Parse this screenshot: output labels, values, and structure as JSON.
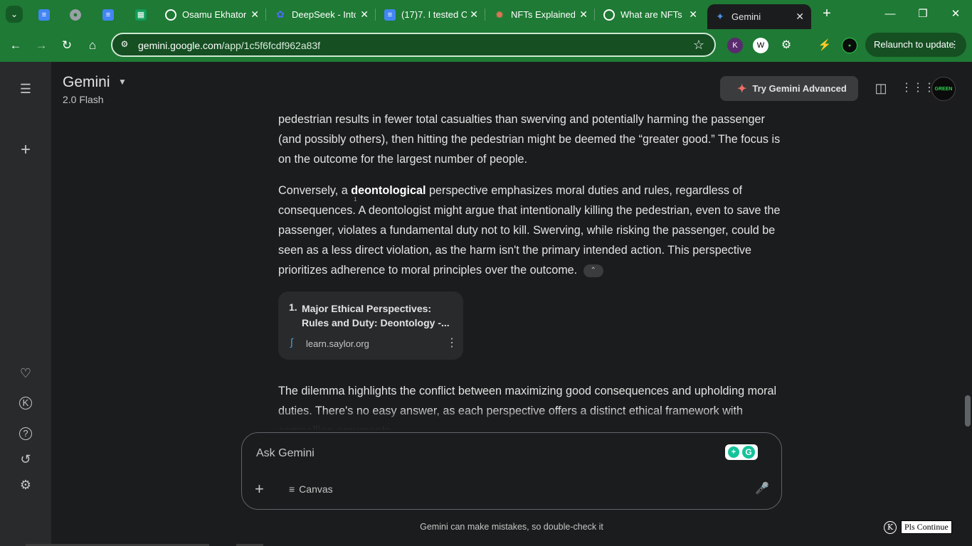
{
  "browser": {
    "tabs": [
      {
        "title": "",
        "icon": "google-docs-icon",
        "color": "#4285f4"
      },
      {
        "title": "",
        "icon": "globe-icon",
        "color": "#9aa0a6"
      },
      {
        "title": "",
        "icon": "google-docs-icon",
        "color": "#4285f4"
      },
      {
        "title": "",
        "icon": "google-sheets-icon",
        "color": "#0f9d58"
      },
      {
        "title": "Osamu Ekhator",
        "icon": "openai-icon",
        "color": "#ffffff"
      },
      {
        "title": "DeepSeek - Into",
        "icon": "deepseek-icon",
        "color": "#4d6bfe"
      },
      {
        "title": "(17)7. I tested C",
        "icon": "google-docs-icon",
        "color": "#4285f4"
      },
      {
        "title": "NFTs Explained",
        "icon": "claude-icon",
        "color": "#d97757"
      },
      {
        "title": "What are NFTs",
        "icon": "openai-icon",
        "color": "#ffffff"
      },
      {
        "title": "Gemini",
        "icon": "gemini-icon",
        "color": "#4a90e2"
      }
    ],
    "url_host": "gemini.google.com",
    "url_path": "/app/1c5f6fcdf962a83f",
    "relaunch_label": "Relaunch to update"
  },
  "header": {
    "title": "Gemini",
    "model": "2.0 Flash",
    "try_advanced": "Try Gemini Advanced"
  },
  "content": {
    "p1": "pedestrian results in fewer total casualties than swerving and potentially harming the passenger (and possibly others), then hitting the pedestrian might be deemed the “greater good.” The focus is on the outcome for the largest number of people.",
    "p2_before": "Conversely, a ",
    "p2_bold": "deontological",
    "p2_after": " perspective emphasizes moral duties and rules, regardless of consequences. A deontologist might argue that intentionally killing the pedestrian, even to save the passenger, violates a fundamental duty not to kill. Swerving, while risking the passenger, could be seen as a less direct violation, as the harm isn't the primary intended action. This perspective prioritizes adherence to moral principles over the outcome.",
    "citation_sup": "1",
    "source": {
      "number": "1.",
      "title": "Major Ethical Perspectives: Rules and Duty: Deontology -...",
      "domain": "learn.saylor.org"
    },
    "p3": "The dilemma highlights the conflict between maximizing good consequences and upholding moral duties. There's no easy answer, as each perspective offers a distinct ethical framework with compelling arguments."
  },
  "input": {
    "placeholder": "Ask Gemini",
    "canvas_label": "Canvas"
  },
  "disclaimer": "Gemini can make mistakes, so double-check it",
  "extension_button": "Pls Continue",
  "colors": {
    "accent": "#1e7a34",
    "background": "#1b1c1d",
    "sidebar": "#282a2c"
  }
}
